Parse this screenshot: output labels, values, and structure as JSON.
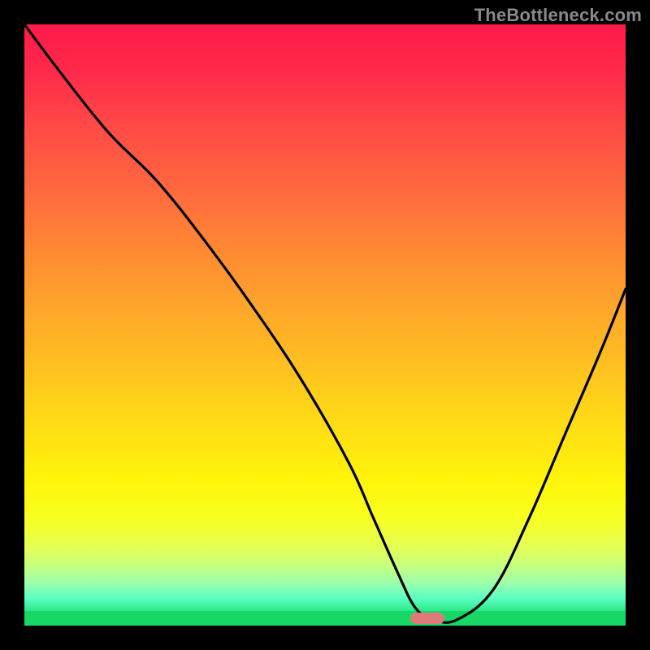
{
  "watermark": "TheBottleneck.com",
  "colors": {
    "frame": "#000000",
    "curve": "#000000",
    "marker": "#e07a7a",
    "gradient_top": "#ff1a4a",
    "gradient_bottom": "#18d865"
  },
  "chart_data": {
    "type": "line",
    "title": "",
    "xlabel": "",
    "ylabel": "",
    "xlim": [
      0,
      100
    ],
    "ylim": [
      0,
      100
    ],
    "grid": false,
    "legend": false,
    "series": [
      {
        "name": "bottleneck-curve",
        "x": [
          0,
          6,
          14,
          22,
          30,
          38,
          46,
          54,
          58,
          62,
          65,
          68,
          72,
          78,
          84,
          90,
          96,
          100
        ],
        "values": [
          100,
          92,
          82,
          74,
          64,
          53,
          41,
          27,
          18,
          9,
          3,
          1,
          1,
          6,
          18,
          32,
          46,
          56
        ]
      }
    ],
    "annotations": [
      {
        "name": "optimal-marker",
        "x": 67,
        "y": 0,
        "width_pct": 5.7
      }
    ],
    "background": "vertical-gradient red→yellow→green (green = 0 bottleneck)"
  }
}
